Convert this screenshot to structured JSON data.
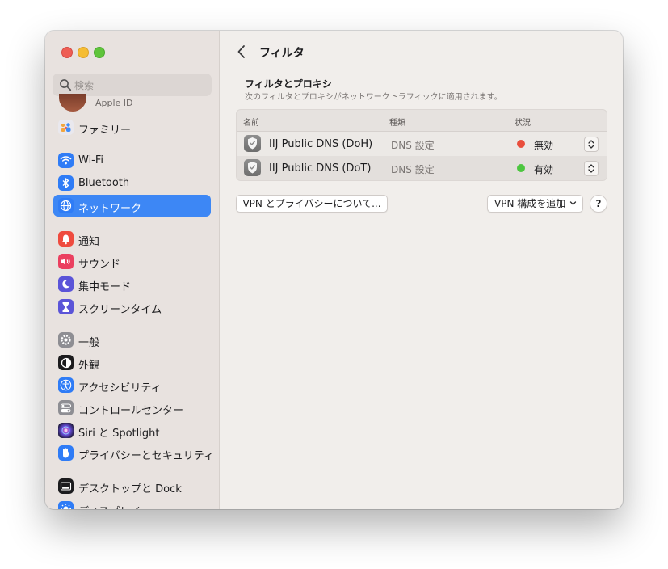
{
  "colors": {
    "accent": "#3d87f5",
    "status_off": "#e94e3c",
    "status_on": "#4cc63f"
  },
  "sidebar": {
    "search_placeholder": "検索",
    "apple_id_label": "Apple ID",
    "items": [
      {
        "label": "ファミリー",
        "icon": "family-icon",
        "color": "#e9e8ee"
      },
      {
        "label": "Wi-Fi",
        "icon": "wifi-icon",
        "color": "#2f7cf6"
      },
      {
        "label": "Bluetooth",
        "icon": "bluetooth-icon",
        "color": "#2f7cf6"
      },
      {
        "label": "ネットワーク",
        "icon": "globe-icon",
        "color": "#2f7cf6",
        "selected": true
      },
      {
        "label": "通知",
        "icon": "bell-icon",
        "color": "#ef4b3f"
      },
      {
        "label": "サウンド",
        "icon": "speaker-icon",
        "color": "#eb3f5f"
      },
      {
        "label": "集中モード",
        "icon": "moon-icon",
        "color": "#5b54d8"
      },
      {
        "label": "スクリーンタイム",
        "icon": "hourglass-icon",
        "color": "#5b54d8"
      },
      {
        "label": "一般",
        "icon": "gear-icon",
        "color": "#8e8e93"
      },
      {
        "label": "外観",
        "icon": "appearance-icon",
        "color": "#1c1c1e"
      },
      {
        "label": "アクセシビリティ",
        "icon": "accessibility-icon",
        "color": "#2f7cf6"
      },
      {
        "label": "コントロールセンター",
        "icon": "control-center-icon",
        "color": "#8e8e93"
      },
      {
        "label": "Siri と Spotlight",
        "icon": "siri-icon",
        "color": "#3a2e6f"
      },
      {
        "label": "プライバシーとセキュリティ",
        "icon": "hand-icon",
        "color": "#2f7cf6"
      },
      {
        "label": "デスクトップと Dock",
        "icon": "dock-icon",
        "color": "#1c1c1e"
      },
      {
        "label": "ディスプレイ",
        "icon": "display-icon",
        "color": "#2f7cf6"
      }
    ]
  },
  "main": {
    "title": "フィルタ",
    "section_title": "フィルタとプロキシ",
    "section_subtitle": "次のフィルタとプロキシがネットワークトラフィックに適用されます。",
    "columns": [
      "名前",
      "種類",
      "状況"
    ],
    "rows": [
      {
        "name": "IIJ Public DNS (DoH)",
        "type": "DNS 設定",
        "status": "無効",
        "enabled": false
      },
      {
        "name": "IIJ Public DNS (DoT)",
        "type": "DNS 設定",
        "status": "有効",
        "enabled": true
      }
    ],
    "vpn_privacy_button": "VPN とプライバシーについて...",
    "add_vpn_button": "VPN 構成を追加",
    "help_button": "?"
  }
}
